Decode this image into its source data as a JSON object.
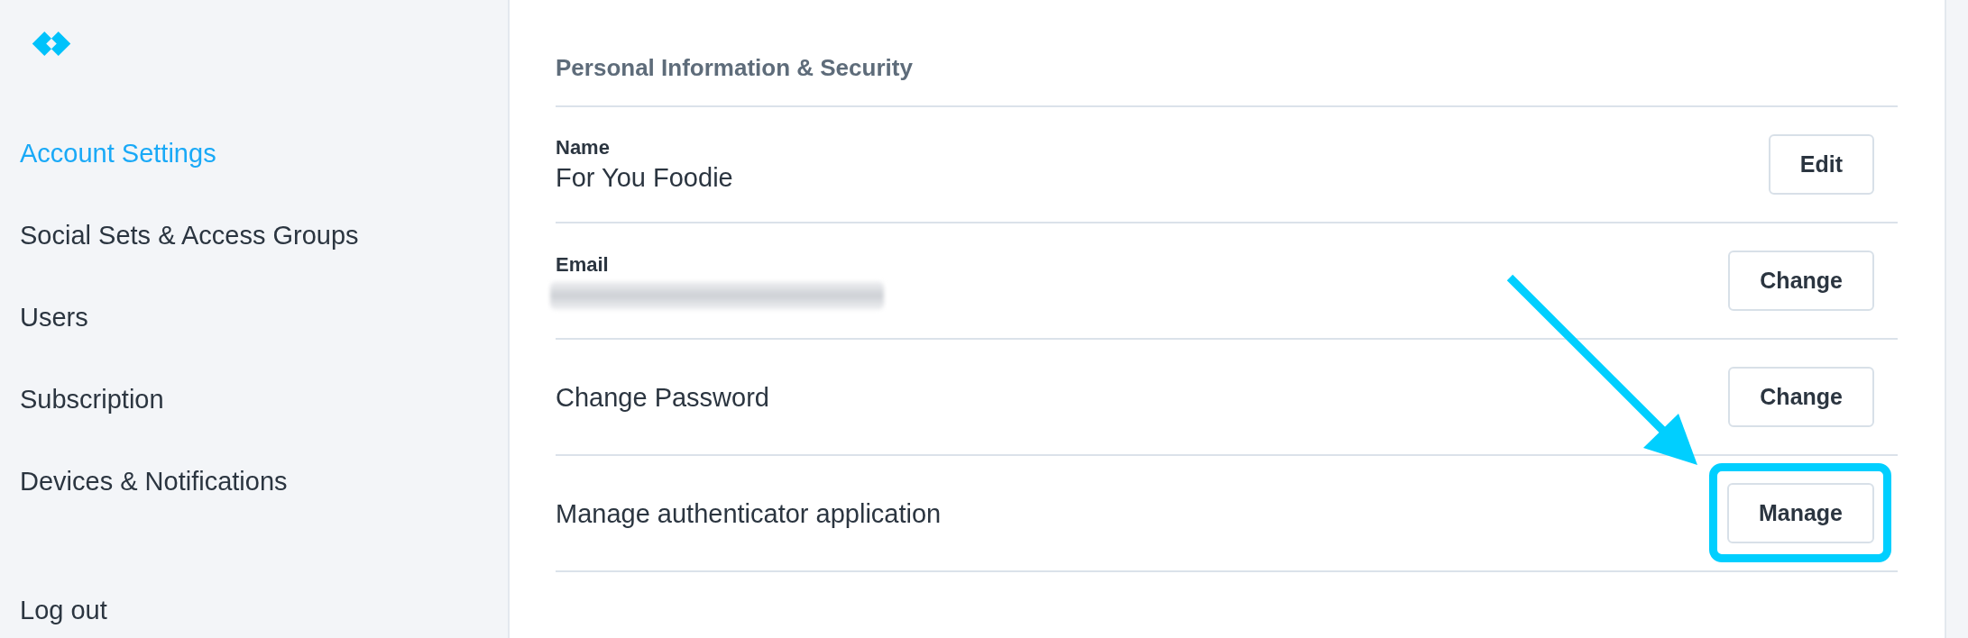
{
  "sidebar": {
    "items": [
      {
        "label": "Account Settings",
        "selected": true
      },
      {
        "label": "Social Sets & Access Groups",
        "selected": false
      },
      {
        "label": "Users",
        "selected": false
      },
      {
        "label": "Subscription",
        "selected": false
      },
      {
        "label": "Devices & Notifications",
        "selected": false
      }
    ],
    "footer_item": {
      "label": "Log out"
    }
  },
  "section": {
    "title": "Personal Information & Security",
    "rows": [
      {
        "kind": "field",
        "label": "Name",
        "value": "For You Foodie",
        "button": "Edit",
        "highlighted": false
      },
      {
        "kind": "field",
        "label": "Email",
        "value_blurred": true,
        "button": "Change",
        "highlighted": false
      },
      {
        "kind": "action",
        "title": "Change Password",
        "button": "Change",
        "highlighted": false
      },
      {
        "kind": "action",
        "title": "Manage authenticator application",
        "button": "Manage",
        "highlighted": true
      }
    ]
  }
}
